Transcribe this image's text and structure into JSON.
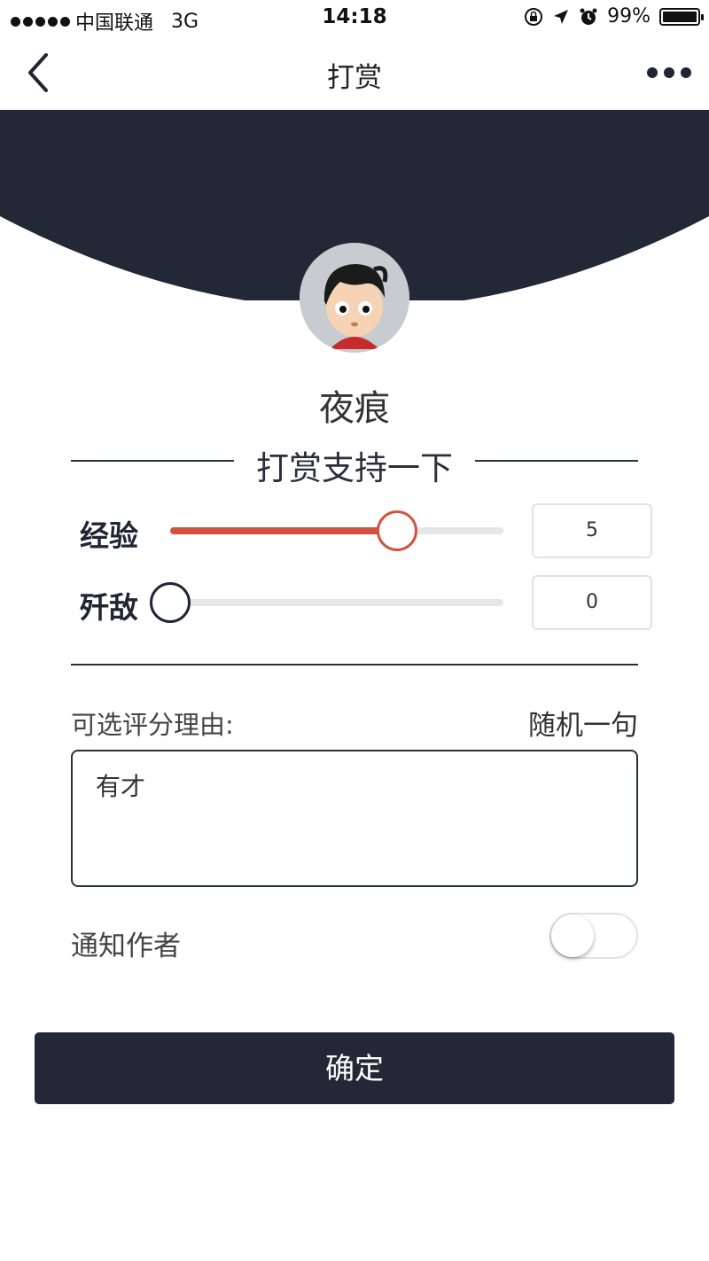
{
  "status_bar": {
    "carrier": "中国联通",
    "network": "3G",
    "time": "14:18",
    "battery": "99%"
  },
  "nav": {
    "title": "打赏",
    "back_icon": "chevron-left-icon",
    "more_icon": "more-dots-icon"
  },
  "profile": {
    "username": "夜痕"
  },
  "section_title": "打赏支持一下",
  "sliders": [
    {
      "label": "经验",
      "value": "5",
      "fraction": 0.68,
      "color": "#d0533f"
    },
    {
      "label": "歼敌",
      "value": "0",
      "fraction": 0.0,
      "color": "#1f2533"
    }
  ],
  "reason": {
    "label": "可选评分理由:",
    "random_label": "随机一句",
    "text": "有才"
  },
  "notify": {
    "label": "通知作者",
    "enabled": false
  },
  "confirm_label": "确定",
  "colors": {
    "dark": "#222835",
    "accent": "#d0533f"
  }
}
